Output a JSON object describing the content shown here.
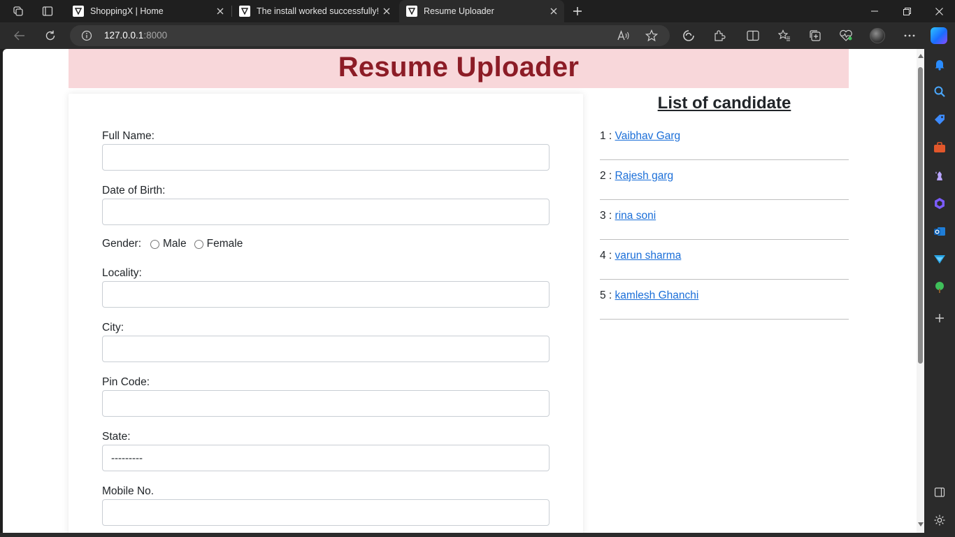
{
  "browser": {
    "tabs": [
      {
        "title": "ShoppingX | Home",
        "active": false
      },
      {
        "title": "The install worked successfully! C",
        "active": false
      },
      {
        "title": "Resume Uploader",
        "active": true
      }
    ],
    "url_host": "127.0.0.1",
    "url_port": ":8000"
  },
  "page": {
    "title": "Resume Uploader",
    "form": {
      "full_name_label": "Full Name:",
      "dob_label": "Date of Birth:",
      "gender_label": "Gender:",
      "gender_options": [
        "Male",
        "Female"
      ],
      "locality_label": "Locality:",
      "city_label": "City:",
      "pin_label": "Pin Code:",
      "state_label": "State:",
      "state_selected": "---------",
      "mobile_label": "Mobile No."
    },
    "candidates": {
      "heading": "List of candidate",
      "items": [
        {
          "index": "1 :",
          "name": "Vaibhav Garg"
        },
        {
          "index": "2 :",
          "name": "Rajesh garg"
        },
        {
          "index": "3 :",
          "name": "rina soni"
        },
        {
          "index": "4 :",
          "name": "varun sharma"
        },
        {
          "index": "5 :",
          "name": "kamlesh Ghanchi"
        }
      ]
    }
  },
  "colors": {
    "header_band": "#f8d7da",
    "title_text": "#8c1c26",
    "link": "#1a6ed8"
  }
}
